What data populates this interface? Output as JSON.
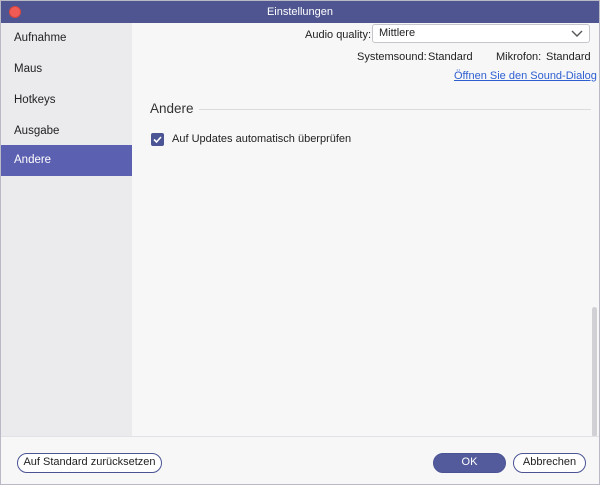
{
  "window": {
    "title": "Einstellungen"
  },
  "sidebar": {
    "items": [
      {
        "label": "Aufnahme"
      },
      {
        "label": "Maus"
      },
      {
        "label": "Hotkeys"
      },
      {
        "label": "Ausgabe"
      },
      {
        "label": "Andere",
        "active": true
      }
    ]
  },
  "audio": {
    "quality_label": "Audio quality:",
    "quality_value": "Mittlere",
    "systemsound_label": "Systemsound:",
    "systemsound_value": "Standard",
    "mikrofon_label": "Mikrofon:",
    "mikrofon_value": "Standard",
    "sound_dialog_link": "Öffnen Sie den Sound-Dialog"
  },
  "andere": {
    "title": "Andere",
    "auto_update_label": "Auf Updates automatisch überprüfen",
    "auto_update_checked": true
  },
  "footer": {
    "reset_label": "Auf Standard zurücksetzen",
    "ok_label": "OK",
    "cancel_label": "Abbrechen"
  },
  "icons": {
    "close": "close-icon",
    "chevron": "chevron-down-icon",
    "check": "check-icon"
  },
  "colors": {
    "accent": "#4f5590",
    "sidebar_active": "#5b60b0",
    "link": "#2d5fd1",
    "close": "#f15b56"
  }
}
